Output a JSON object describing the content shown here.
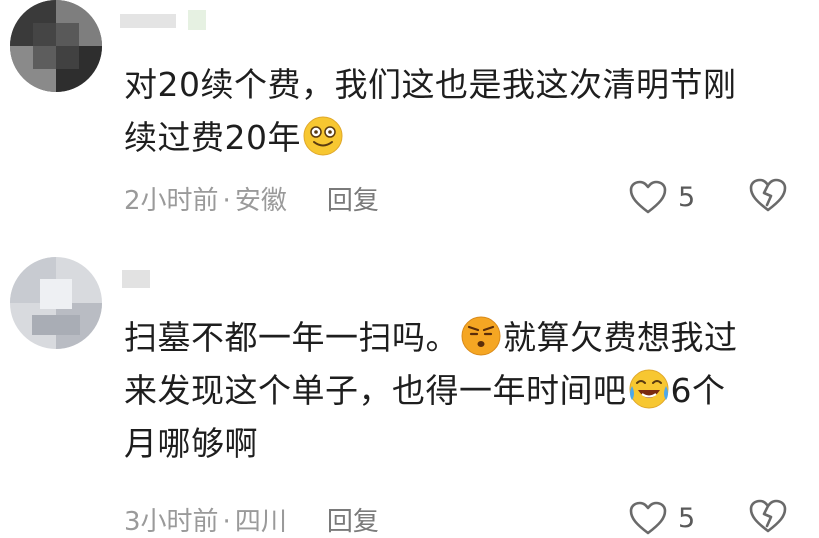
{
  "comments": [
    {
      "lines": [
        "对20续个费，我们这也是我这次清明节刚",
        "续过费20年"
      ],
      "emoji": "smiling-face-emoji",
      "time": "2小时前",
      "location": "安徽",
      "separator": "·",
      "reply_label": "回复",
      "likes": "5"
    },
    {
      "lines": [
        "扫墓不都一年一扫吗。",
        "就算欠费想我过",
        "来发现这个单子，也得一年时间吧",
        "6个",
        "月哪够啊"
      ],
      "emojis": [
        "frowning-face-emoji",
        "crying-laughing-face-emoji"
      ],
      "time": "3小时前",
      "location": "四川",
      "separator": "·",
      "reply_label": "回复",
      "likes": "5"
    }
  ],
  "colors": {
    "text": "#1e1e1e",
    "meta": "#9a9a9a",
    "icon": "#6a6a6a",
    "emoji_yellow": "#f7c731",
    "emoji_orange": "#f5a623"
  }
}
